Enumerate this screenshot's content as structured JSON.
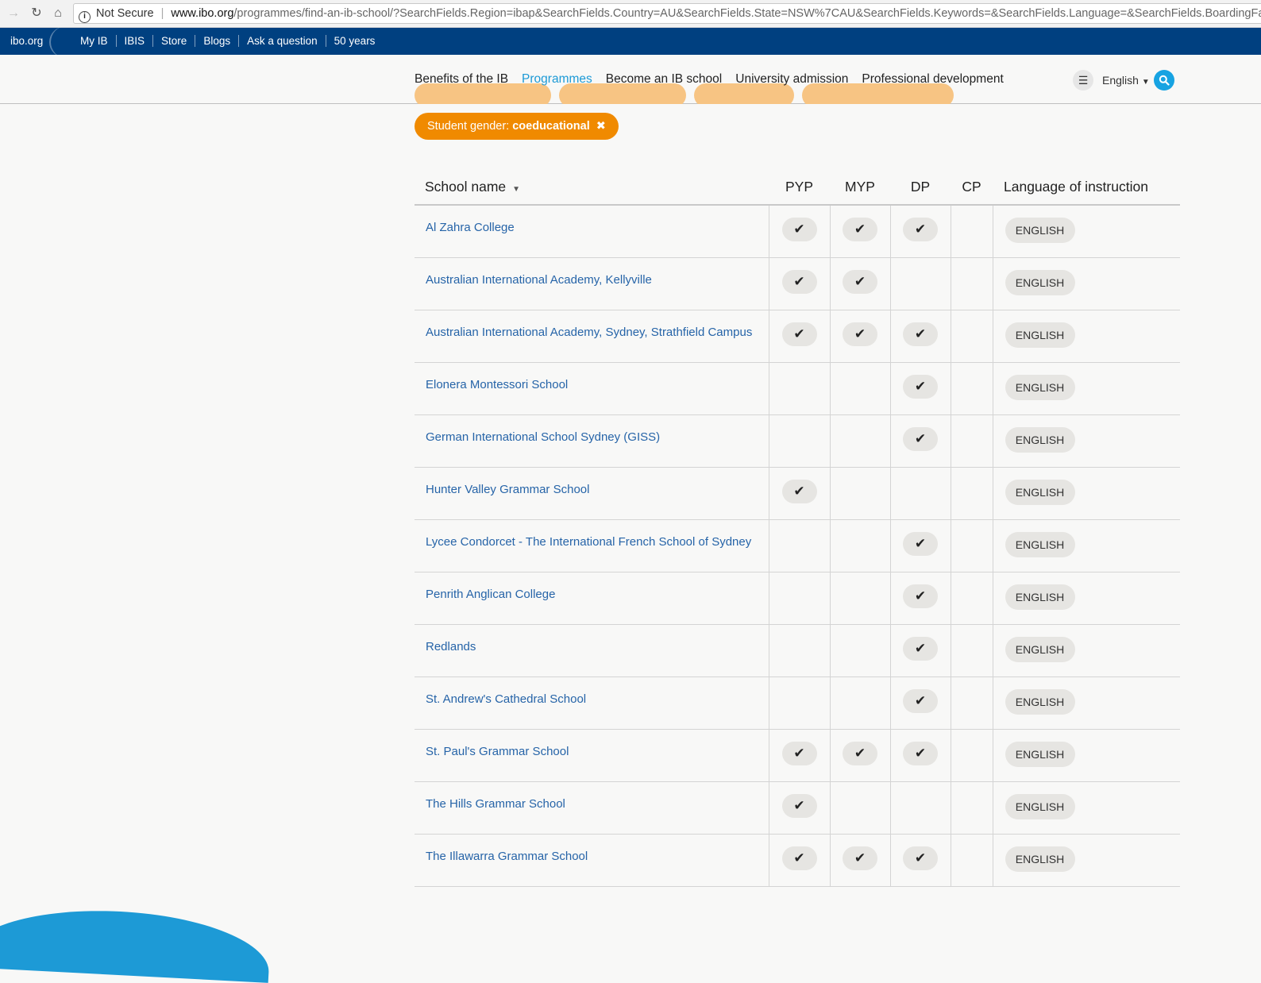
{
  "browser": {
    "security_label": "Not Secure",
    "url_host": "www.ibo.org",
    "url_path": "/programmes/find-an-ib-school/?SearchFields.Region=ibap&SearchFields.Country=AU&SearchFields.State=NSW%7CAU&SearchFields.Keywords=&SearchFields.Language=&SearchFields.BoardingFacilities=&SearchFields.SchoolGender=coeducational"
  },
  "utility_bar": {
    "brand": "ibo.org",
    "links": [
      "My IB",
      "IBIS",
      "Store",
      "Blogs",
      "Ask a question",
      "50 years"
    ]
  },
  "main_nav": {
    "items": [
      "Benefits of the IB",
      "Programmes",
      "Become an IB school",
      "University admission",
      "Professional development"
    ],
    "active_index": 1,
    "language": "English"
  },
  "filter": {
    "label": "Student gender: ",
    "value": "coeducational",
    "remove": "✖"
  },
  "table": {
    "headers": {
      "name": "School name",
      "pyp": "PYP",
      "myp": "MYP",
      "dp": "DP",
      "cp": "CP",
      "language": "Language of instruction"
    },
    "check_glyph": "✔",
    "rows": [
      {
        "name": "Al Zahra College",
        "pyp": true,
        "myp": true,
        "dp": true,
        "cp": false,
        "language": "ENGLISH"
      },
      {
        "name": "Australian International Academy, Kellyville",
        "pyp": true,
        "myp": true,
        "dp": false,
        "cp": false,
        "language": "ENGLISH"
      },
      {
        "name": "Australian International Academy, Sydney, Strathfield Campus",
        "pyp": true,
        "myp": true,
        "dp": true,
        "cp": false,
        "language": "ENGLISH"
      },
      {
        "name": "Elonera Montessori School",
        "pyp": false,
        "myp": false,
        "dp": true,
        "cp": false,
        "language": "ENGLISH"
      },
      {
        "name": "German International School Sydney (GISS)",
        "pyp": false,
        "myp": false,
        "dp": true,
        "cp": false,
        "language": "ENGLISH"
      },
      {
        "name": "Hunter Valley Grammar School",
        "pyp": true,
        "myp": false,
        "dp": false,
        "cp": false,
        "language": "ENGLISH"
      },
      {
        "name": "Lycee Condorcet - The International French School of Sydney",
        "pyp": false,
        "myp": false,
        "dp": true,
        "cp": false,
        "language": "ENGLISH"
      },
      {
        "name": "Penrith Anglican College",
        "pyp": false,
        "myp": false,
        "dp": true,
        "cp": false,
        "language": "ENGLISH"
      },
      {
        "name": "Redlands",
        "pyp": false,
        "myp": false,
        "dp": true,
        "cp": false,
        "language": "ENGLISH"
      },
      {
        "name": "St. Andrew's Cathedral School",
        "pyp": false,
        "myp": false,
        "dp": true,
        "cp": false,
        "language": "ENGLISH"
      },
      {
        "name": "St. Paul's Grammar School",
        "pyp": true,
        "myp": true,
        "dp": true,
        "cp": false,
        "language": "ENGLISH"
      },
      {
        "name": "The Hills Grammar School",
        "pyp": true,
        "myp": false,
        "dp": false,
        "cp": false,
        "language": "ENGLISH"
      },
      {
        "name": "The Illawarra Grammar School",
        "pyp": true,
        "myp": true,
        "dp": true,
        "cp": false,
        "language": "ENGLISH"
      }
    ]
  }
}
